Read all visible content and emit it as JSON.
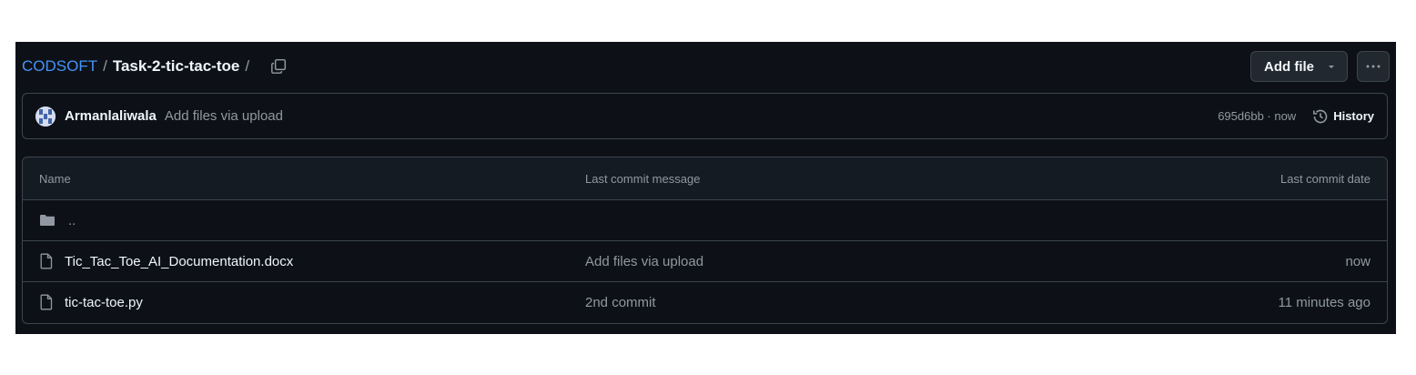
{
  "breadcrumb": {
    "owner": "CODSOFT",
    "separator": "/",
    "repo_path": "Task-2-tic-tac-toe",
    "trailing_separator": "/"
  },
  "actions": {
    "add_file_label": "Add file",
    "more_label": "···"
  },
  "latest_commit": {
    "author": "Armanlaliwala",
    "message": "Add files via upload",
    "sha_time": "695d6bb · now",
    "history_label": "History"
  },
  "table": {
    "columns": [
      "Name",
      "Last commit message",
      "Last commit date"
    ],
    "parent_dir": "..",
    "rows": [
      {
        "name": "Tic_Tac_Toe_AI_Documentation.docx",
        "message": "Add files via upload",
        "date": "now",
        "icon": "file-icon"
      },
      {
        "name": "tic-tac-toe.py",
        "message": "2nd commit",
        "date": "11 minutes ago",
        "icon": "file-icon"
      }
    ]
  },
  "colors": {
    "background": "#0d1117",
    "link": "#4493f8",
    "border": "#3d444d",
    "muted": "#9198a1"
  }
}
